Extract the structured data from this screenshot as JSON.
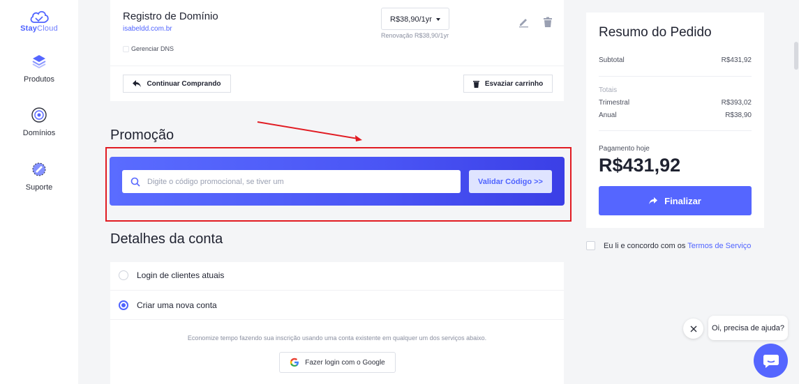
{
  "brand": {
    "name_bold": "Stay",
    "name_light": "Cloud",
    "color": "#4f63ff"
  },
  "sidebar": {
    "items": [
      {
        "label": "Produtos",
        "icon": "layers-icon"
      },
      {
        "label": "Domínios",
        "icon": "globe-icon"
      },
      {
        "label": "Suporte",
        "icon": "support-icon"
      }
    ]
  },
  "cart_item": {
    "title": "Registro de Domínio",
    "domain": "isabeldd.com.br",
    "dns_label": "Gerenciar DNS",
    "price_option": "R$38,90/1yr",
    "renewal": "Renovação R$38,90/1yr",
    "continue_label": "Continuar Comprando",
    "empty_label": "Esvaziar carrinho"
  },
  "promo": {
    "title": "Promoção",
    "placeholder": "Digite o código promocional, se tiver um",
    "validate_label": "Validar Código >>"
  },
  "account": {
    "title": "Detalhes da conta",
    "option_login": "Login de clientes atuais",
    "option_new": "Criar uma nova conta",
    "selected": "Criar uma nova conta",
    "info": "Economize tempo fazendo sua inscrição usando uma conta existente em qualquer um dos serviços abaixo.",
    "google_label": "Fazer login com o Google"
  },
  "summary": {
    "title": "Resumo do Pedido",
    "subtotal_label": "Subtotal",
    "subtotal_value": "R$431,92",
    "totals_label": "Totais",
    "quarterly_label": "Trimestral",
    "quarterly_value": "R$393,02",
    "annual_label": "Anual",
    "annual_value": "R$38,90",
    "today_label": "Pagamento hoje",
    "today_value": "R$431,92",
    "finalize_label": "Finalizar"
  },
  "terms": {
    "text": "Eu li e concordo com os",
    "link": "Termos de Serviço"
  },
  "chat": {
    "bubble_text": "Oi, precisa de ajuda?"
  },
  "colors": {
    "accent": "#5566ff",
    "highlight": "#e11b22"
  }
}
